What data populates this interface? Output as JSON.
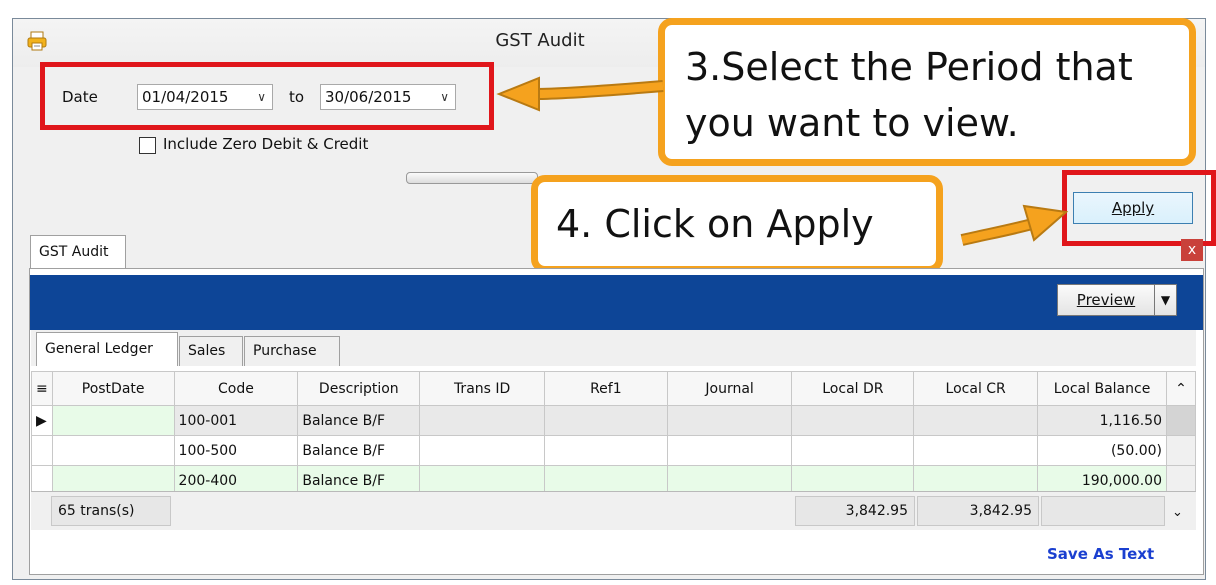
{
  "window": {
    "title": "GST Audit"
  },
  "filter": {
    "date_label": "Date",
    "from_date": "01/04/2015",
    "to_label": "to",
    "to_date": "30/06/2015",
    "include_zero_label": "Include Zero Debit & Credit",
    "apply_label": "Apply"
  },
  "callouts": {
    "step3": "3.Select the Period that you want to view.",
    "step4": "4. Click on Apply"
  },
  "tabs": {
    "main": "GST Audit",
    "close": "x"
  },
  "toolbar": {
    "preview_label": "Preview"
  },
  "subtabs": [
    "General Ledger",
    "Sales",
    "Purchase"
  ],
  "table": {
    "columns": [
      "PostDate",
      "Code",
      "Description",
      "Trans ID",
      "Ref1",
      "Journal",
      "Local DR",
      "Local CR",
      "Local Balance"
    ],
    "rows": [
      {
        "postdate": "",
        "code": "100-001",
        "description": "Balance B/F",
        "trans_id": "",
        "ref1": "",
        "journal": "",
        "local_dr": "",
        "local_cr": "",
        "local_balance": "1,116.50"
      },
      {
        "postdate": "",
        "code": "100-500",
        "description": "Balance B/F",
        "trans_id": "",
        "ref1": "",
        "journal": "",
        "local_dr": "",
        "local_cr": "",
        "local_balance": "(50.00)"
      },
      {
        "postdate": "",
        "code": "200-400",
        "description": "Balance B/F",
        "trans_id": "",
        "ref1": "",
        "journal": "",
        "local_dr": "",
        "local_cr": "",
        "local_balance": "190,000.00"
      }
    ],
    "footer": {
      "count": "65 trans(s)",
      "total_dr": "3,842.95",
      "total_cr": "3,842.95"
    }
  },
  "save_as_text_label": "Save As Text",
  "colors": {
    "callout_border": "#f5a21e",
    "highlight_red": "#e0161b",
    "toolbar_blue": "#0d4597",
    "link_blue": "#1a3fd0"
  }
}
